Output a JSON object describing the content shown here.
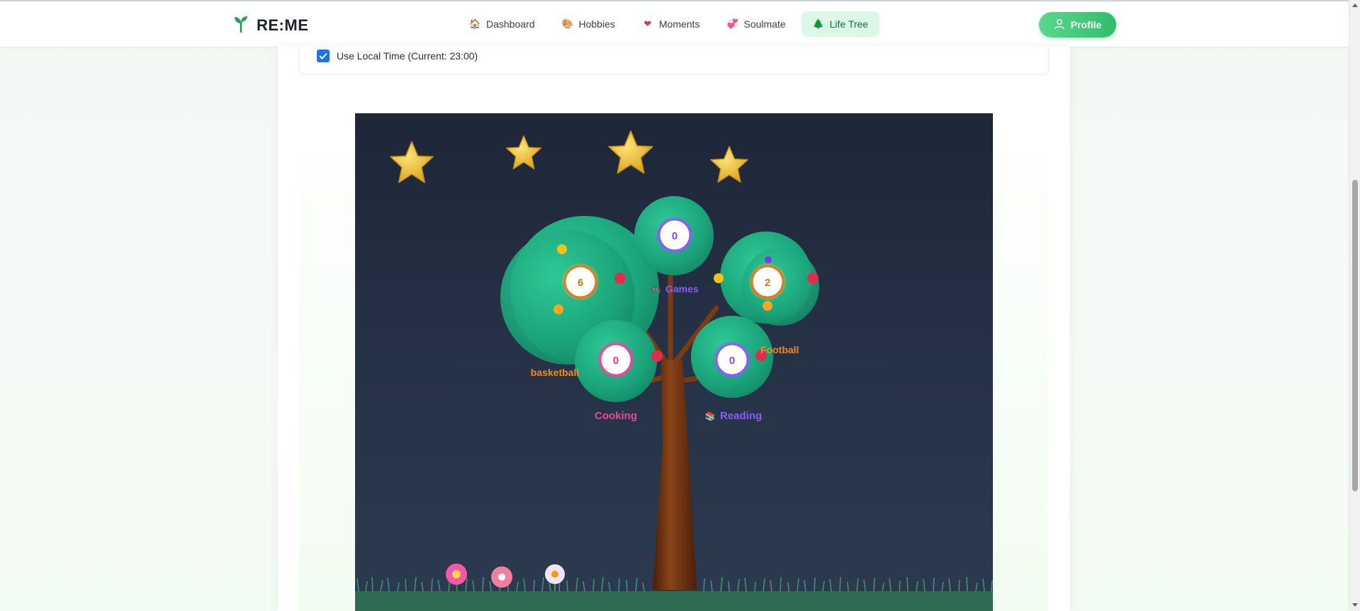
{
  "app": {
    "brand": "RE:ME"
  },
  "nav": [
    {
      "label": "Dashboard",
      "icon": "house-icon",
      "glyph": "🏠",
      "active": false
    },
    {
      "label": "Hobbies",
      "icon": "palette-icon",
      "glyph": "🎨",
      "active": false
    },
    {
      "label": "Moments",
      "icon": "heart-icon",
      "glyph": "❤",
      "active": false
    },
    {
      "label": "Soulmate",
      "icon": "hearts-icon",
      "glyph": "💞",
      "active": false
    },
    {
      "label": "Life Tree",
      "icon": "tree-icon",
      "glyph": "🌲",
      "active": true
    }
  ],
  "profile": {
    "label": "Profile"
  },
  "settings": {
    "use_local_time_label": "Use Local Time (Current: 23:00)",
    "use_local_time_checked": true
  },
  "tree": {
    "branches": [
      {
        "name": "basketball",
        "count": "6",
        "color": "#f08a24"
      },
      {
        "name": "Games",
        "count": "0",
        "color": "#8b5cf6",
        "icon": "gamepad-icon"
      },
      {
        "name": "Football",
        "count": "2",
        "color": "#f08a24"
      },
      {
        "name": "Cooking",
        "count": "0",
        "color": "#ec4899"
      },
      {
        "name": "Reading",
        "count": "0",
        "color": "#8b5cf6",
        "icon": "books-icon"
      }
    ]
  },
  "colors": {
    "accent": "#2fbe6b",
    "leaf": "#1fa57a",
    "sky": "#1e2638",
    "trunk": "#7a3a12"
  }
}
